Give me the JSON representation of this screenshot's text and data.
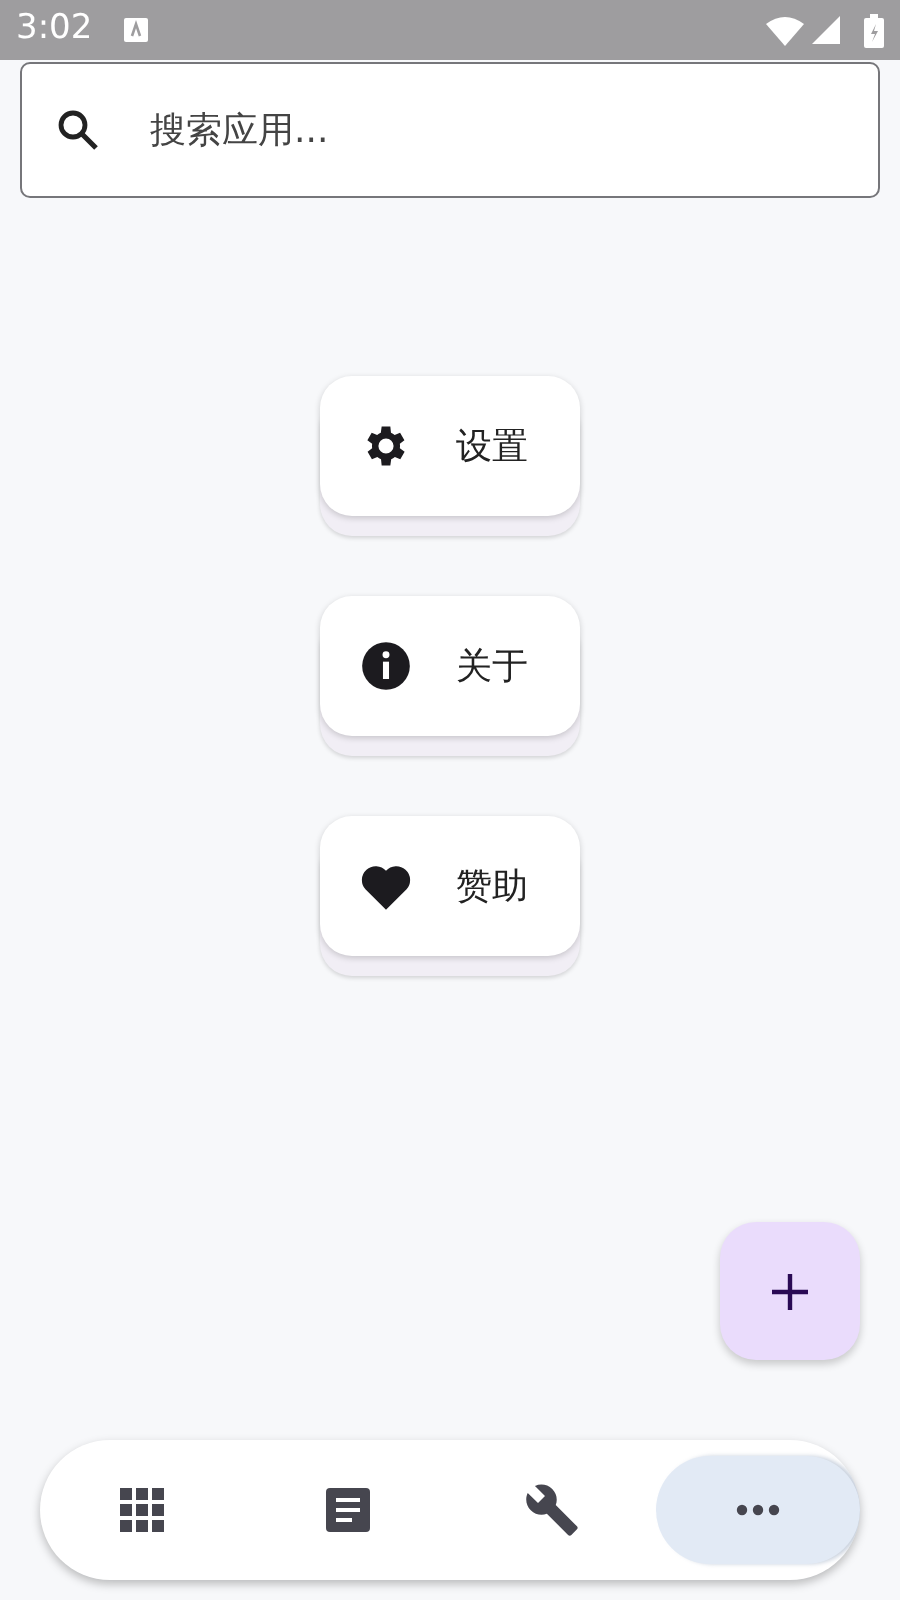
{
  "status_bar": {
    "time": "3:02"
  },
  "search": {
    "placeholder": "搜索应用..."
  },
  "menu": [
    {
      "kind": "settings",
      "label": "设置"
    },
    {
      "kind": "info",
      "label": "关于"
    },
    {
      "kind": "heart",
      "label": "赞助"
    }
  ],
  "bottom_nav": [
    {
      "kind": "apps",
      "selected": false
    },
    {
      "kind": "notes",
      "selected": false
    },
    {
      "kind": "tools",
      "selected": false
    },
    {
      "kind": "more",
      "selected": true
    }
  ]
}
